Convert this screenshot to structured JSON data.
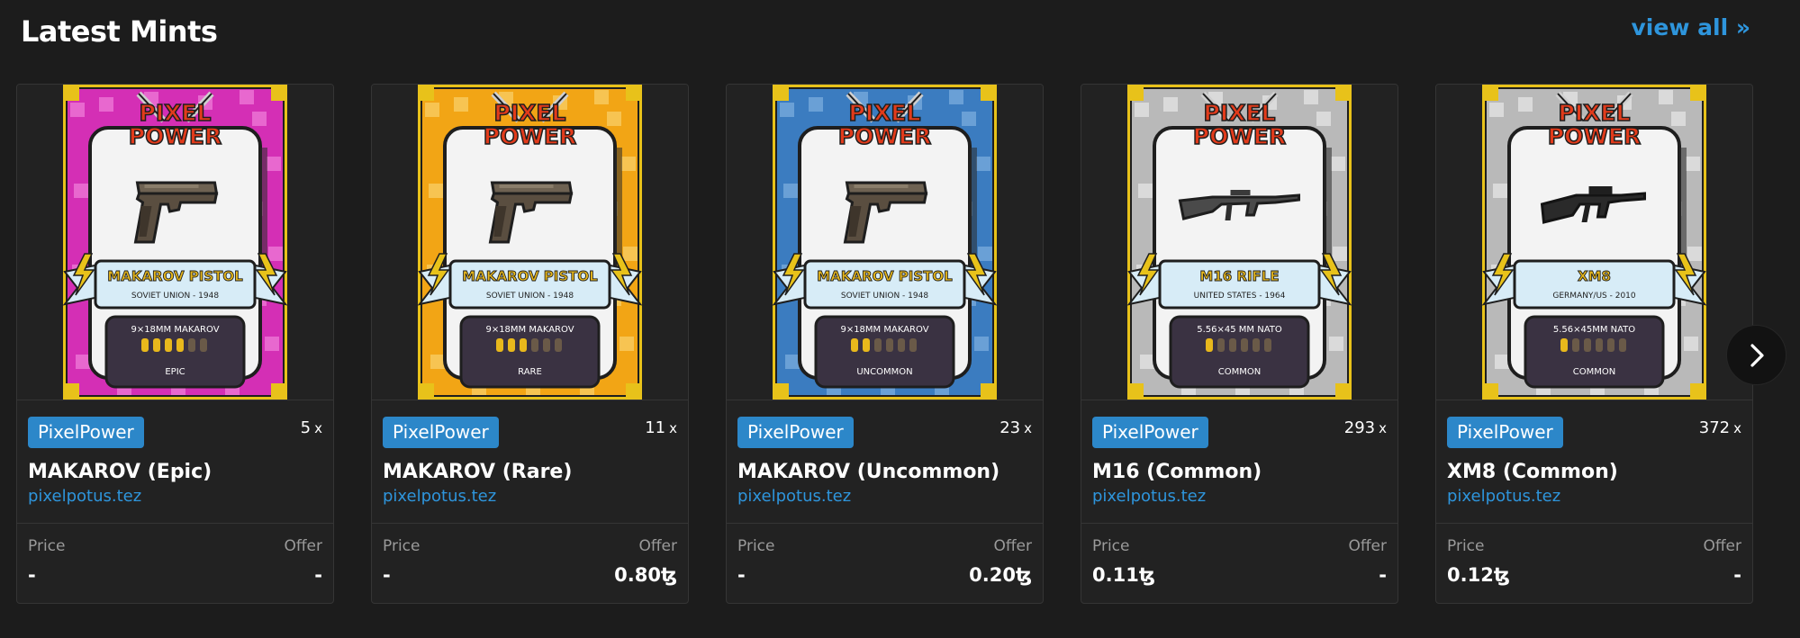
{
  "section": {
    "title": "Latest Mints",
    "view_all": "view all »"
  },
  "colors": {
    "background": "#1c1c1c",
    "card": "#222222",
    "accent": "#2e95dc",
    "tag": "#2c87c9"
  },
  "icons": {
    "next": "chevron-right-icon",
    "currency": "tezos-icon"
  },
  "cards": [
    {
      "tag": "PixelPower",
      "edition_count": "5",
      "edition_suffix": "x",
      "name": "MAKAROV (Epic)",
      "creator": "pixelpotus.tez",
      "price_label": "Price",
      "offer_label": "Offer",
      "price": "-",
      "offer": "-",
      "art": {
        "brand_line1": "PIXEL",
        "brand_line2": "POWER",
        "weapon": "pistol",
        "title": "MAKAROV PISTOL",
        "subtitle": "SOVIET UNION - 1948",
        "caliber": "9×18MM MAKAROV",
        "ammo_filled": 4,
        "ammo_total": 6,
        "rarity": "EPIC",
        "frame_color": "#d42fb5",
        "frame_light": "#e868cf"
      }
    },
    {
      "tag": "PixelPower",
      "edition_count": "11",
      "edition_suffix": "x",
      "name": "MAKAROV (Rare)",
      "creator": "pixelpotus.tez",
      "price_label": "Price",
      "offer_label": "Offer",
      "price": "-",
      "offer": "0.80ꜩ",
      "art": {
        "brand_line1": "PIXEL",
        "brand_line2": "POWER",
        "weapon": "pistol",
        "title": "MAKAROV PISTOL",
        "subtitle": "SOVIET UNION - 1948",
        "caliber": "9×18MM MAKAROV",
        "ammo_filled": 3,
        "ammo_total": 6,
        "rarity": "RARE",
        "frame_color": "#f2a515",
        "frame_light": "#f7c452"
      }
    },
    {
      "tag": "PixelPower",
      "edition_count": "23",
      "edition_suffix": "x",
      "name": "MAKAROV (Uncommon)",
      "creator": "pixelpotus.tez",
      "price_label": "Price",
      "offer_label": "Offer",
      "price": "-",
      "offer": "0.20ꜩ",
      "art": {
        "brand_line1": "PIXEL",
        "brand_line2": "POWER",
        "weapon": "pistol",
        "title": "MAKAROV PISTOL",
        "subtitle": "SOVIET UNION - 1948",
        "caliber": "9×18MM MAKAROV",
        "ammo_filled": 2,
        "ammo_total": 6,
        "rarity": "UNCOMMON",
        "frame_color": "#3b7cc0",
        "frame_light": "#6aa0d6"
      }
    },
    {
      "tag": "PixelPower",
      "edition_count": "293",
      "edition_suffix": "x",
      "name": "M16 (Common)",
      "creator": "pixelpotus.tez",
      "price_label": "Price",
      "offer_label": "Offer",
      "price": "0.11ꜩ",
      "offer": "-",
      "art": {
        "brand_line1": "PIXEL",
        "brand_line2": "POWER",
        "weapon": "rifle",
        "title": "M16 RIFLE",
        "subtitle": "UNITED STATES - 1964",
        "caliber": "5.56×45 MM NATO",
        "ammo_filled": 1,
        "ammo_total": 6,
        "rarity": "COMMON",
        "frame_color": "#b9b9b9",
        "frame_light": "#dadada"
      }
    },
    {
      "tag": "PixelPower",
      "edition_count": "372",
      "edition_suffix": "x",
      "name": "XM8 (Common)",
      "creator": "pixelpotus.tez",
      "price_label": "Price",
      "offer_label": "Offer",
      "price": "0.12ꜩ",
      "offer": "-",
      "art": {
        "brand_line1": "PIXEL",
        "brand_line2": "POWER",
        "weapon": "smg",
        "title": "XM8",
        "subtitle": "GERMANY/US - 2010",
        "caliber": "5.56×45MM NATO",
        "ammo_filled": 1,
        "ammo_total": 6,
        "rarity": "COMMON",
        "frame_color": "#b9b9b9",
        "frame_light": "#dadada"
      }
    }
  ]
}
